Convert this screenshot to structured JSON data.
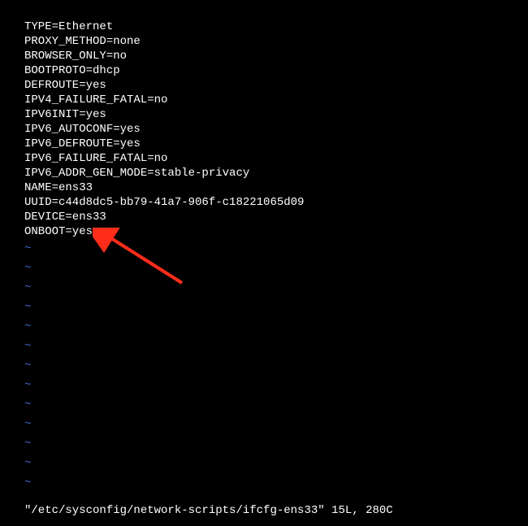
{
  "config": {
    "lines": [
      "TYPE=Ethernet",
      "PROXY_METHOD=none",
      "BROWSER_ONLY=no",
      "BOOTPROTO=dhcp",
      "DEFROUTE=yes",
      "IPV4_FAILURE_FATAL=no",
      "IPV6INIT=yes",
      "IPV6_AUTOCONF=yes",
      "IPV6_DEFROUTE=yes",
      "IPV6_FAILURE_FATAL=no",
      "IPV6_ADDR_GEN_MODE=stable-privacy",
      "NAME=ens33",
      "UUID=c44d8dc5-bb79-41a7-906f-c18221065d09",
      "DEVICE=ens33",
      "ONBOOT=yes"
    ]
  },
  "tilde_count": 13,
  "status": "\"/etc/sysconfig/network-scripts/ifcfg-ens33\" 15L, 280C",
  "annotation": {
    "type": "arrow",
    "color": "#ff2d1a"
  }
}
